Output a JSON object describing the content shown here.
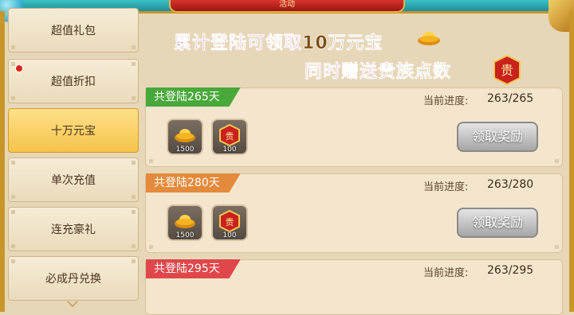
{
  "header": {
    "title_fragment": "活动"
  },
  "sidebar": {
    "items": [
      {
        "label": "超值礼包",
        "active": false,
        "dot": false
      },
      {
        "label": "超值折扣",
        "active": false,
        "dot": true
      },
      {
        "label": "十万元宝",
        "active": true,
        "dot": false
      },
      {
        "label": "单次充值",
        "active": false,
        "dot": false
      },
      {
        "label": "连充豪礼",
        "active": false,
        "dot": false
      },
      {
        "label": "必成丹兑换",
        "active": false,
        "dot": false
      }
    ]
  },
  "banner": {
    "line1_prefix": "累计登陆可领取",
    "line1_amount": "10万元宝",
    "line2_prefix": "同时赠送",
    "line2_highlight": "贵族点数",
    "noble_glyph": "贵"
  },
  "cards": [
    {
      "tag": "共登陆265天",
      "tag_color": "#49a83a",
      "progress_label": "当前进度:",
      "progress": "263/265",
      "rewards": [
        {
          "icon": "gold-ingot-icon",
          "qty": "1500"
        },
        {
          "icon": "noble-badge-icon",
          "glyph": "贵",
          "qty": "100"
        }
      ],
      "button": "领取奖励"
    },
    {
      "tag": "共登陆280天",
      "tag_color": "#e48a3c",
      "progress_label": "当前进度:",
      "progress": "263/280",
      "rewards": [
        {
          "icon": "gold-ingot-icon",
          "qty": "1500"
        },
        {
          "icon": "noble-badge-icon",
          "glyph": "贵",
          "qty": "100"
        }
      ],
      "button": "领取奖励"
    },
    {
      "tag": "共登陆295天",
      "tag_color": "#e0474a",
      "progress_label": "当前进度:",
      "progress": "263/295",
      "rewards": [],
      "button": ""
    }
  ]
}
